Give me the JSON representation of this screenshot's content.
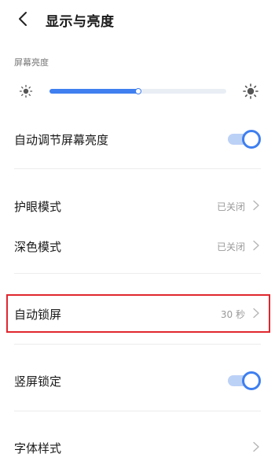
{
  "header": {
    "title": "显示与亮度"
  },
  "brightness": {
    "section_label": "屏幕亮度",
    "level": 0.5
  },
  "settings": {
    "auto_brightness": {
      "label": "自动调节屏幕亮度",
      "enabled": true
    },
    "eye_protection": {
      "label": "护眼模式",
      "value": "已关闭"
    },
    "dark_mode": {
      "label": "深色模式",
      "value": "已关闭"
    },
    "auto_lock": {
      "label": "自动锁屏",
      "value": "30 秒"
    },
    "portrait_lock": {
      "label": "竖屏锁定",
      "enabled": true
    },
    "font_style": {
      "label": "字体样式"
    }
  },
  "colors": {
    "accent": "#3f7ff0",
    "highlight": "#e0272f"
  }
}
